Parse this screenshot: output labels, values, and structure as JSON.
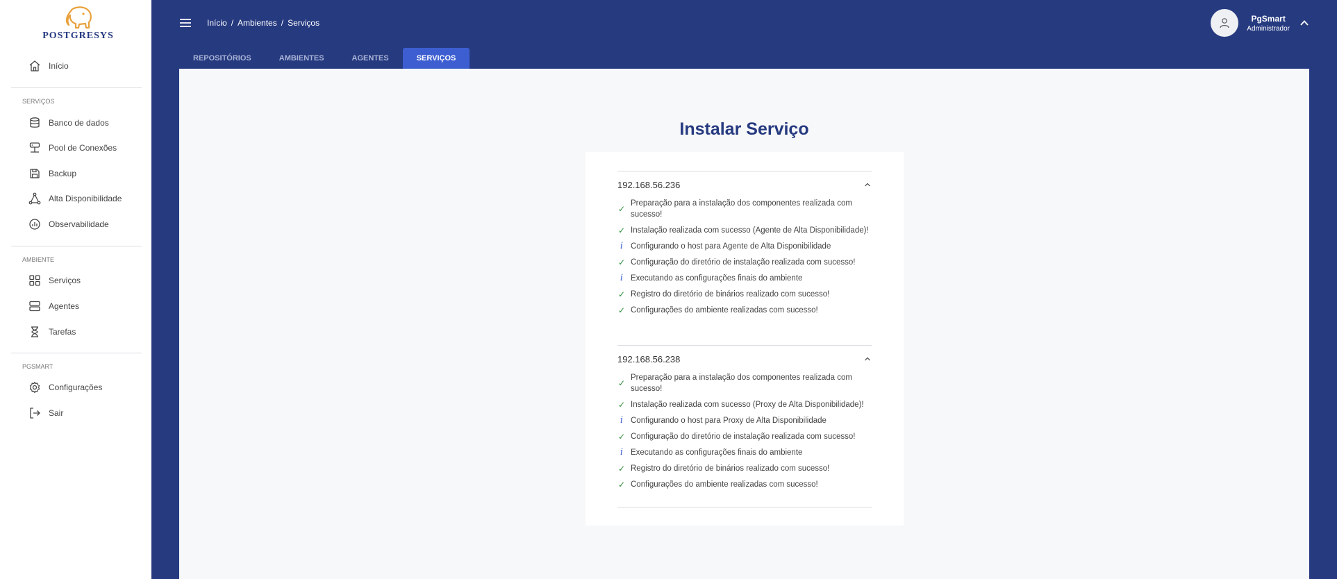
{
  "logo": {
    "text": "POSTGRESYS"
  },
  "sidebar": {
    "home": "Início",
    "sections": [
      {
        "title": "SERVIÇOS",
        "items": [
          "Banco de dados",
          "Pool de Conexões",
          "Backup",
          "Alta Disponibilidade",
          "Observabilidade"
        ]
      },
      {
        "title": "AMBIENTE",
        "items": [
          "Serviços",
          "Agentes",
          "Tarefas"
        ]
      },
      {
        "title": "PGSMART",
        "items": [
          "Configurações",
          "Sair"
        ]
      }
    ]
  },
  "header": {
    "breadcrumb": [
      "Início",
      "Ambientes",
      "Serviços"
    ],
    "separator": "/",
    "user": {
      "name": "PgSmart",
      "role": "Administrador"
    }
  },
  "tabs": [
    {
      "label": "REPOSITÓRIOS",
      "active": false
    },
    {
      "label": "AMBIENTES",
      "active": false
    },
    {
      "label": "AGENTES",
      "active": false
    },
    {
      "label": "SERVIÇOS",
      "active": true
    }
  ],
  "main": {
    "title": "Instalar Serviço",
    "hosts": [
      {
        "ip": "192.168.56.236",
        "logs": [
          {
            "type": "success",
            "text": "Preparação para a instalação dos componentes realizada com sucesso!"
          },
          {
            "type": "success",
            "text": "Instalação realizada com sucesso (Agente de Alta Disponibilidade)!"
          },
          {
            "type": "info",
            "text": "Configurando o host para Agente de Alta Disponibilidade"
          },
          {
            "type": "success",
            "text": "Configuração do diretório de instalação realizada com sucesso!"
          },
          {
            "type": "info",
            "text": "Executando as configurações finais do ambiente"
          },
          {
            "type": "success",
            "text": "Registro do diretório de binários realizado com sucesso!"
          },
          {
            "type": "success",
            "text": "Configurações do ambiente realizadas com sucesso!"
          }
        ]
      },
      {
        "ip": "192.168.56.238",
        "logs": [
          {
            "type": "success",
            "text": "Preparação para a instalação dos componentes realizada com sucesso!"
          },
          {
            "type": "success",
            "text": "Instalação realizada com sucesso (Proxy de Alta Disponibilidade)!"
          },
          {
            "type": "info",
            "text": "Configurando o host para Proxy de Alta Disponibilidade"
          },
          {
            "type": "success",
            "text": "Configuração do diretório de instalação realizada com sucesso!"
          },
          {
            "type": "info",
            "text": "Executando as configurações finais do ambiente"
          },
          {
            "type": "success",
            "text": "Registro do diretório de binários realizado com sucesso!"
          },
          {
            "type": "success",
            "text": "Configurações do ambiente realizadas com sucesso!"
          }
        ]
      }
    ]
  },
  "icons": {
    "check": "✓",
    "info": "i"
  },
  "colors": {
    "brand": "#263a80",
    "tab_active": "#3d5ed1",
    "success": "#2e8b3a",
    "info": "#3d5ed1"
  }
}
